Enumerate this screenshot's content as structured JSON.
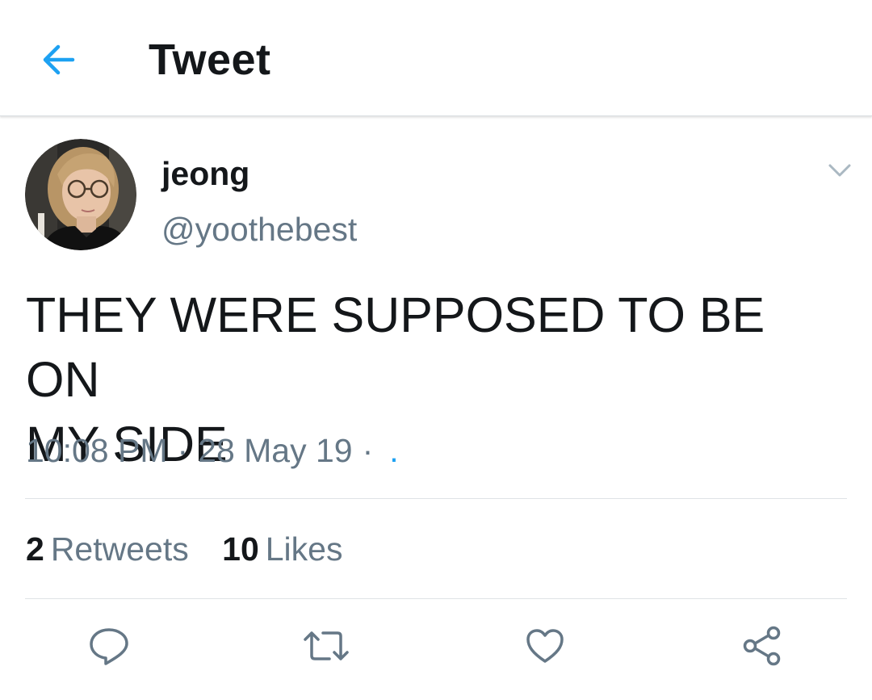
{
  "header": {
    "back_icon": "arrow-left-icon",
    "title": "Tweet",
    "accent_color": "#1da1f2"
  },
  "tweet": {
    "display_name": "jeong",
    "handle": "@yoothebest",
    "caret_icon": "chevron-down-icon",
    "text_line_1": "THEY WERE SUPPOSED TO BE ON",
    "text_line_2": "MY SIDE",
    "time": "10:08 PM",
    "separator": "·",
    "date": "28 May 19",
    "via": "."
  },
  "stats": {
    "retweets_count": "2",
    "retweets_label": "Retweets",
    "likes_count": "10",
    "likes_label": "Likes"
  },
  "actions": [
    {
      "icon": "reply-icon"
    },
    {
      "icon": "retweet-icon"
    },
    {
      "icon": "like-heart-icon"
    },
    {
      "icon": "share-icon"
    }
  ],
  "colors": {
    "text_primary": "#14171a",
    "text_secondary": "#657786",
    "divider": "#dfe3e6",
    "icon_gray": "#657786"
  }
}
